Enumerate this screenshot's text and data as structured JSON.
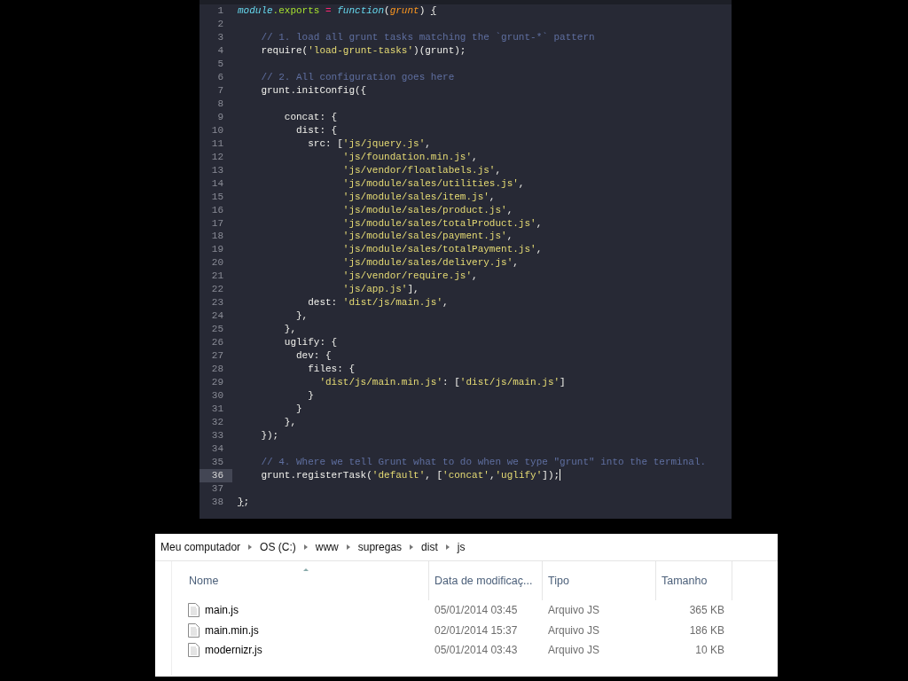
{
  "editor": {
    "lines": [
      {
        "number": "1",
        "selected": false,
        "tokens": [
          {
            "kind": "variable",
            "text": "module"
          },
          {
            "kind": "property",
            "text": ".exports "
          },
          {
            "kind": "operator",
            "text": "= "
          },
          {
            "kind": "storage",
            "text": "function"
          },
          {
            "kind": "plain",
            "text": "("
          },
          {
            "kind": "parameter",
            "text": "grunt"
          },
          {
            "kind": "plain",
            "text": ") "
          },
          {
            "kind": "bracket",
            "text": "{"
          }
        ]
      },
      {
        "number": "2",
        "selected": false
      },
      {
        "number": "3",
        "selected": false,
        "tokens": [
          {
            "kind": "comment",
            "text": "    // 1. load all grunt tasks matching the `grunt-*` pattern"
          }
        ]
      },
      {
        "number": "4",
        "selected": false,
        "tokens": [
          {
            "kind": "plain",
            "text": "    require("
          },
          {
            "kind": "string",
            "text": "'load-grunt-tasks'"
          },
          {
            "kind": "plain",
            "text": ")(grunt);"
          }
        ]
      },
      {
        "number": "5",
        "selected": false
      },
      {
        "number": "6",
        "selected": false,
        "tokens": [
          {
            "kind": "comment",
            "text": "    // 2. All configuration goes here"
          }
        ]
      },
      {
        "number": "7",
        "selected": false,
        "tokens": [
          {
            "kind": "plain",
            "text": "    grunt.initConfig({"
          }
        ]
      },
      {
        "number": "8",
        "selected": false
      },
      {
        "number": "9",
        "selected": false,
        "tokens": [
          {
            "kind": "plain",
            "text": "        concat: {"
          }
        ]
      },
      {
        "number": "10",
        "selected": false,
        "tokens": [
          {
            "kind": "plain",
            "text": "          dist: {"
          }
        ]
      },
      {
        "number": "11",
        "selected": false,
        "tokens": [
          {
            "kind": "plain",
            "text": "            src: ["
          },
          {
            "kind": "string",
            "text": "'js/jquery.js'"
          },
          {
            "kind": "plain",
            "text": ","
          }
        ]
      },
      {
        "number": "12",
        "selected": false,
        "tokens": [
          {
            "kind": "string",
            "text": "                  'js/foundation.min.js'"
          },
          {
            "kind": "plain",
            "text": ","
          }
        ]
      },
      {
        "number": "13",
        "selected": false,
        "tokens": [
          {
            "kind": "string",
            "text": "                  'js/vendor/floatlabels.js'"
          },
          {
            "kind": "plain",
            "text": ","
          }
        ]
      },
      {
        "number": "14",
        "selected": false,
        "tokens": [
          {
            "kind": "string",
            "text": "                  'js/module/sales/utilities.js'"
          },
          {
            "kind": "plain",
            "text": ","
          }
        ]
      },
      {
        "number": "15",
        "selected": false,
        "tokens": [
          {
            "kind": "string",
            "text": "                  'js/module/sales/item.js'"
          },
          {
            "kind": "plain",
            "text": ","
          }
        ]
      },
      {
        "number": "16",
        "selected": false,
        "tokens": [
          {
            "kind": "string",
            "text": "                  'js/module/sales/product.js'"
          },
          {
            "kind": "plain",
            "text": ","
          }
        ]
      },
      {
        "number": "17",
        "selected": false,
        "tokens": [
          {
            "kind": "string",
            "text": "                  'js/module/sales/totalProduct.js'"
          },
          {
            "kind": "plain",
            "text": ","
          }
        ]
      },
      {
        "number": "18",
        "selected": false,
        "tokens": [
          {
            "kind": "string",
            "text": "                  'js/module/sales/payment.js'"
          },
          {
            "kind": "plain",
            "text": ","
          }
        ]
      },
      {
        "number": "19",
        "selected": false,
        "tokens": [
          {
            "kind": "string",
            "text": "                  'js/module/sales/totalPayment.js'"
          },
          {
            "kind": "plain",
            "text": ","
          }
        ]
      },
      {
        "number": "20",
        "selected": false,
        "tokens": [
          {
            "kind": "string",
            "text": "                  'js/module/sales/delivery.js'"
          },
          {
            "kind": "plain",
            "text": ","
          }
        ]
      },
      {
        "number": "21",
        "selected": false,
        "tokens": [
          {
            "kind": "string",
            "text": "                  'js/vendor/require.js'"
          },
          {
            "kind": "plain",
            "text": ","
          }
        ]
      },
      {
        "number": "22",
        "selected": false,
        "tokens": [
          {
            "kind": "string",
            "text": "                  'js/app.js'"
          },
          {
            "kind": "plain",
            "text": "],"
          }
        ]
      },
      {
        "number": "23",
        "selected": false,
        "tokens": [
          {
            "kind": "plain",
            "text": "            dest: "
          },
          {
            "kind": "string",
            "text": "'dist/js/main.js'"
          },
          {
            "kind": "plain",
            "text": ","
          }
        ]
      },
      {
        "number": "24",
        "selected": false,
        "tokens": [
          {
            "kind": "plain",
            "text": "          },"
          }
        ]
      },
      {
        "number": "25",
        "selected": false,
        "tokens": [
          {
            "kind": "plain",
            "text": "        },"
          }
        ]
      },
      {
        "number": "26",
        "selected": false,
        "tokens": [
          {
            "kind": "plain",
            "text": "        uglify: {"
          }
        ]
      },
      {
        "number": "27",
        "selected": false,
        "tokens": [
          {
            "kind": "plain",
            "text": "          dev: {"
          }
        ]
      },
      {
        "number": "28",
        "selected": false,
        "tokens": [
          {
            "kind": "plain",
            "text": "            files: {"
          }
        ]
      },
      {
        "number": "29",
        "selected": false,
        "tokens": [
          {
            "kind": "string",
            "text": "              'dist/js/main.min.js'"
          },
          {
            "kind": "plain",
            "text": ": ["
          },
          {
            "kind": "string",
            "text": "'dist/js/main.js'"
          },
          {
            "kind": "plain",
            "text": "]"
          }
        ]
      },
      {
        "number": "30",
        "selected": false,
        "tokens": [
          {
            "kind": "plain",
            "text": "            }"
          }
        ]
      },
      {
        "number": "31",
        "selected": false,
        "tokens": [
          {
            "kind": "plain",
            "text": "          }"
          }
        ]
      },
      {
        "number": "32",
        "selected": false,
        "tokens": [
          {
            "kind": "plain",
            "text": "        },"
          }
        ]
      },
      {
        "number": "33",
        "selected": false,
        "tokens": [
          {
            "kind": "plain",
            "text": "    });"
          }
        ]
      },
      {
        "number": "34",
        "selected": false
      },
      {
        "number": "35",
        "selected": false,
        "tokens": [
          {
            "kind": "comment",
            "text": "    // 4. Where we tell Grunt what to do when we type \"grunt\" into the terminal."
          }
        ]
      },
      {
        "number": "36",
        "selected": true,
        "tokens": [
          {
            "kind": "plain",
            "text": "    grunt.registerTask("
          },
          {
            "kind": "string",
            "text": "'default'"
          },
          {
            "kind": "plain",
            "text": ", ["
          },
          {
            "kind": "string",
            "text": "'concat'"
          },
          {
            "kind": "plain",
            "text": ","
          },
          {
            "kind": "string",
            "text": "'uglify'"
          },
          {
            "kind": "plain",
            "text": "]);"
          }
        ]
      },
      {
        "number": "37",
        "selected": false
      },
      {
        "number": "38",
        "selected": false,
        "tokens": [
          {
            "kind": "bracket",
            "text": "}"
          },
          {
            "kind": "plain",
            "text": ";"
          }
        ]
      }
    ]
  },
  "explorer": {
    "breadcrumb": [
      "Meu computador",
      "OS (C:)",
      "www",
      "supregas",
      "dist",
      "js"
    ],
    "columns": [
      {
        "label": "Nome",
        "sorted": true
      },
      {
        "label": "Data de modificaç...",
        "sorted": false
      },
      {
        "label": "Tipo",
        "sorted": false
      },
      {
        "label": "Tamanho",
        "sorted": false
      }
    ],
    "files": [
      {
        "name": "main.js",
        "modified": "05/01/2014 03:45",
        "type": "Arquivo JS",
        "size": "365 KB"
      },
      {
        "name": "main.min.js",
        "modified": "02/01/2014 15:37",
        "type": "Arquivo JS",
        "size": "186 KB"
      },
      {
        "name": "modernizr.js",
        "modified": "05/01/2014 03:43",
        "type": "Arquivo JS",
        "size": "10 KB"
      }
    ]
  }
}
